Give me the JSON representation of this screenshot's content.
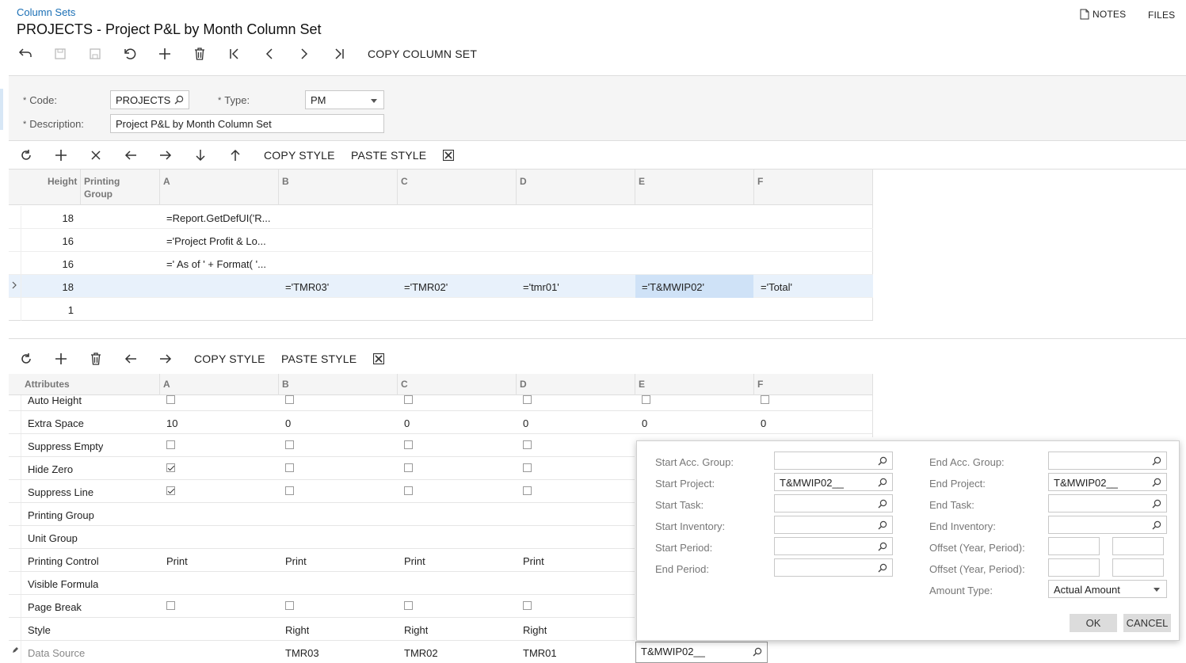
{
  "breadcrumb": "Column Sets",
  "title": "PROJECTS - Project P&L by Month Column Set",
  "top_links": {
    "notes": "NOTES",
    "files": "FILES"
  },
  "toolbar": {
    "copy_column_set": "COPY COLUMN SET"
  },
  "form": {
    "code_label": "Code:",
    "code_value": "PROJECTS",
    "type_label": "Type:",
    "type_value": "PM",
    "description_label": "Description:",
    "description_value": "Project P&L by Month Column Set"
  },
  "grid1": {
    "toolbar": {
      "copy_style": "COPY STYLE",
      "paste_style": "PASTE STYLE"
    },
    "headers": {
      "height": "Height",
      "printing_group_1": "Printing",
      "printing_group_2": "Group",
      "a": "A",
      "b": "B",
      "c": "C",
      "d": "D",
      "e": "E",
      "f": "F"
    },
    "rows": [
      {
        "height": "18",
        "a": "=Report.GetDefUI('R...",
        "b": "",
        "c": "",
        "d": "",
        "e": "",
        "f": ""
      },
      {
        "height": "16",
        "a": "='Project Profit & Lo...",
        "b": "",
        "c": "",
        "d": "",
        "e": "",
        "f": ""
      },
      {
        "height": "16",
        "a": "=' As of ' + Format( '...",
        "b": "",
        "c": "",
        "d": "",
        "e": "",
        "f": ""
      },
      {
        "height": "18",
        "a": "",
        "b": "='TMR03'",
        "c": "='TMR02'",
        "d": "='tmr01'",
        "e": "='T&MWIP02'",
        "f": "='Total'"
      },
      {
        "height": "1",
        "a": "",
        "b": "",
        "c": "",
        "d": "",
        "e": "",
        "f": ""
      }
    ]
  },
  "grid2": {
    "toolbar": {
      "copy_style": "COPY STYLE",
      "paste_style": "PASTE STYLE"
    },
    "headers": {
      "attributes": "Attributes",
      "a": "A",
      "b": "B",
      "c": "C",
      "d": "D",
      "e": "E",
      "f": "F"
    },
    "rows": {
      "auto_height": "Auto Height",
      "extra_space": "Extra Space",
      "extra_space_values": [
        "10",
        "0",
        "0",
        "0",
        "0",
        "0"
      ],
      "suppress_empty": "Suppress Empty",
      "hide_zero": "Hide Zero",
      "suppress_line": "Suppress Line",
      "printing_group": "Printing Group",
      "unit_group": "Unit Group",
      "printing_control": "Printing Control",
      "printing_control_values": [
        "Print",
        "Print",
        "Print",
        "Print"
      ],
      "visible_formula": "Visible Formula",
      "page_break": "Page Break",
      "style": "Style",
      "style_values": [
        "Right",
        "Right",
        "Right"
      ],
      "data_source": "Data Source",
      "data_source_values": [
        "TMR03",
        "TMR02",
        "TMR01",
        "T&MWIP02__"
      ]
    }
  },
  "popup": {
    "start_acc_group": "Start Acc. Group:",
    "start_project": "Start Project:",
    "start_project_value": "T&MWIP02__",
    "start_task": "Start Task:",
    "start_inventory": "Start Inventory:",
    "start_period": "Start Period:",
    "end_period": "End Period:",
    "end_acc_group": "End Acc. Group:",
    "end_project": "End Project:",
    "end_project_value": "T&MWIP02__",
    "end_task": "End Task:",
    "end_inventory": "End Inventory:",
    "offset_1": "Offset (Year, Period):",
    "offset_2": "Offset (Year, Period):",
    "amount_type": "Amount Type:",
    "amount_type_value": "Actual Amount",
    "ok": "OK",
    "cancel": "CANCEL"
  }
}
